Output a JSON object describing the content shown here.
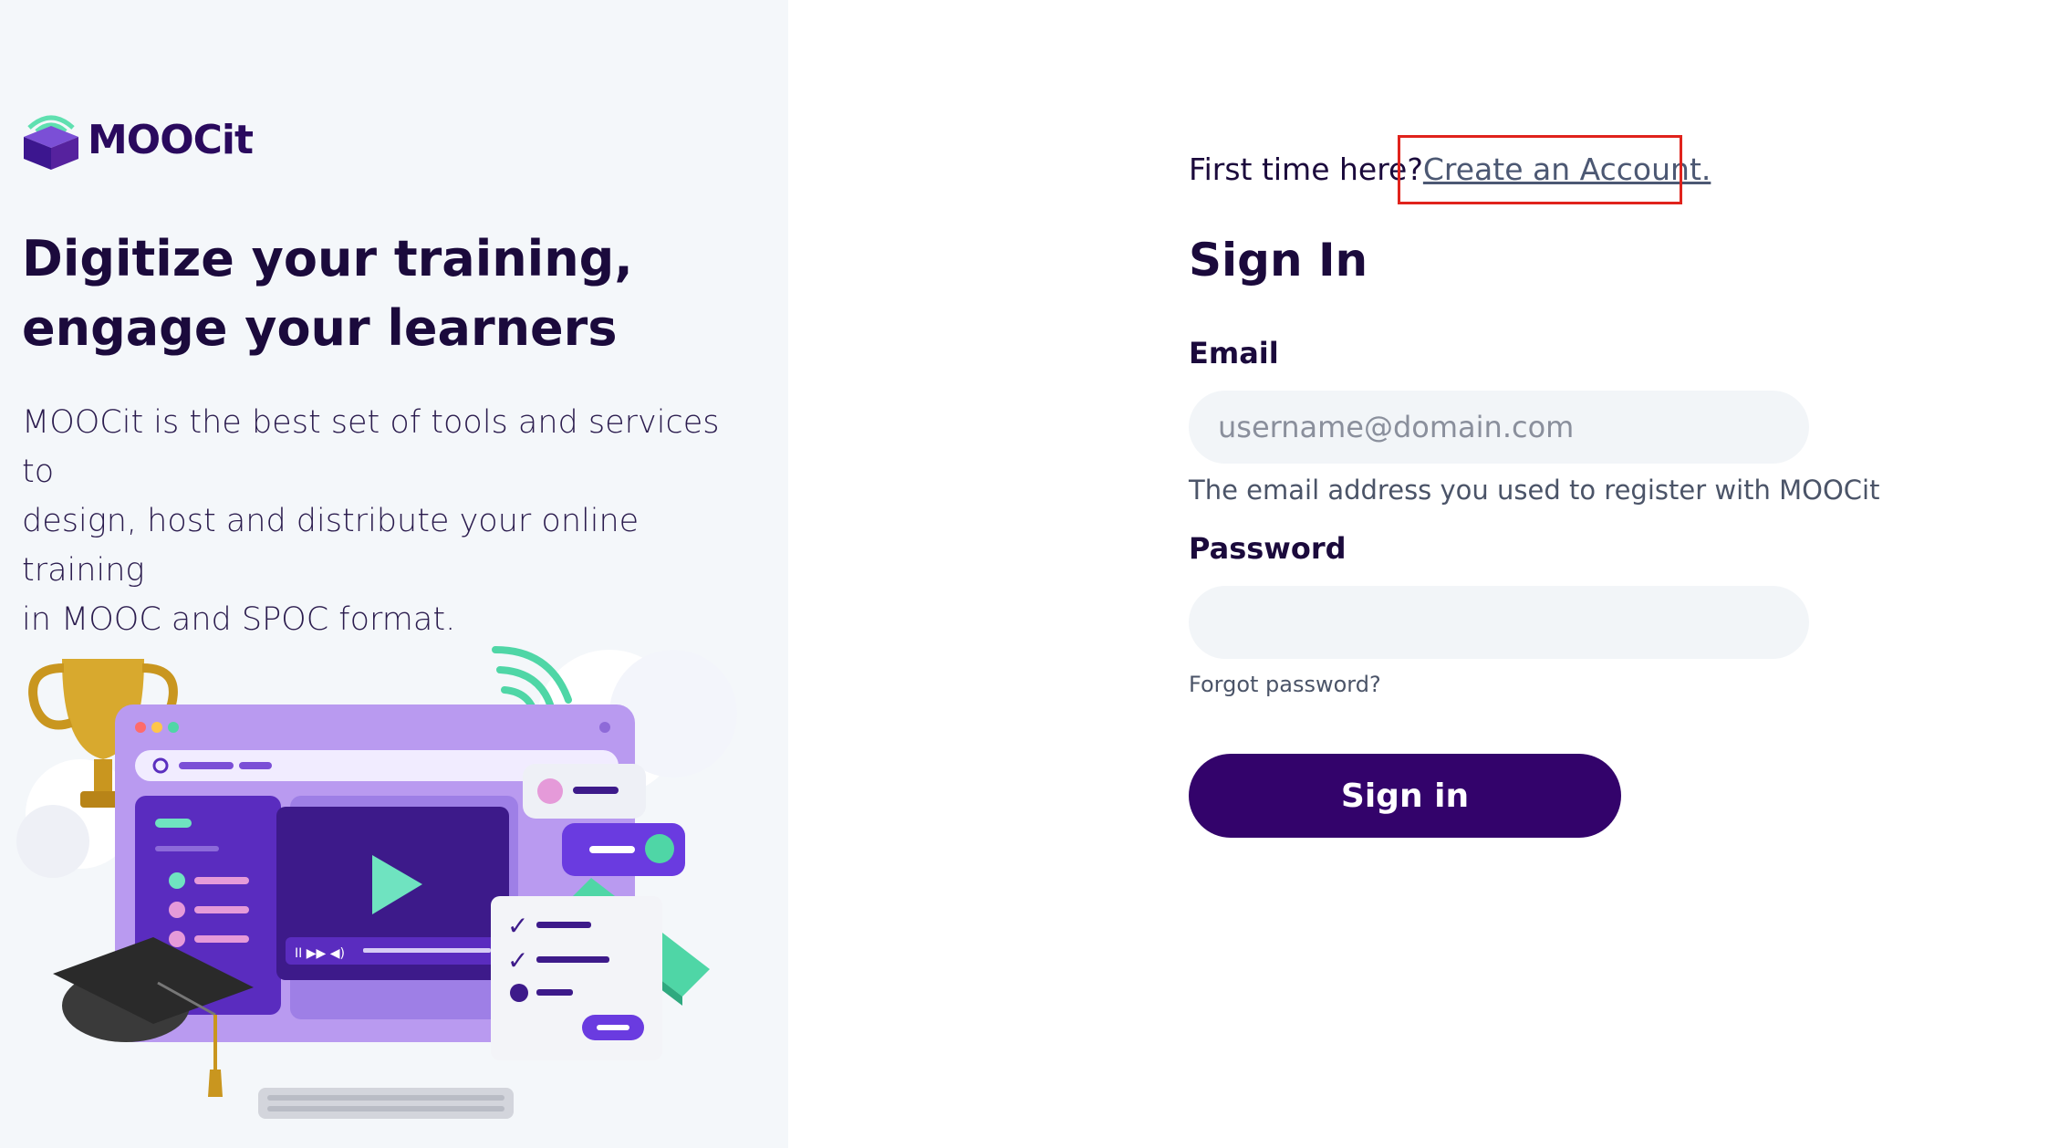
{
  "brand": {
    "name": "MOOCit"
  },
  "marketing": {
    "headline_line1": "Digitize your training,",
    "headline_line2": "engage your learners",
    "intro_line1": "MOOCit is the best set of tools and services to",
    "intro_line2": "design, host and distribute your online training",
    "intro_line3": "in MOOC and SPOC format."
  },
  "signup": {
    "prompt": "First time here?",
    "link_label": "Create an Account."
  },
  "form": {
    "title": "Sign In",
    "email_label": "Email",
    "email_placeholder": "username@domain.com",
    "email_value": "",
    "email_help": "The email address you used to register with MOOCit",
    "password_label": "Password",
    "password_value": "",
    "forgot_label": "Forgot password?",
    "submit_label": "Sign in"
  },
  "colors": {
    "primary": "#33036b",
    "accent_green": "#4fd6a6",
    "highlight_red": "#e0231c",
    "left_bg": "#f4f7fa"
  }
}
